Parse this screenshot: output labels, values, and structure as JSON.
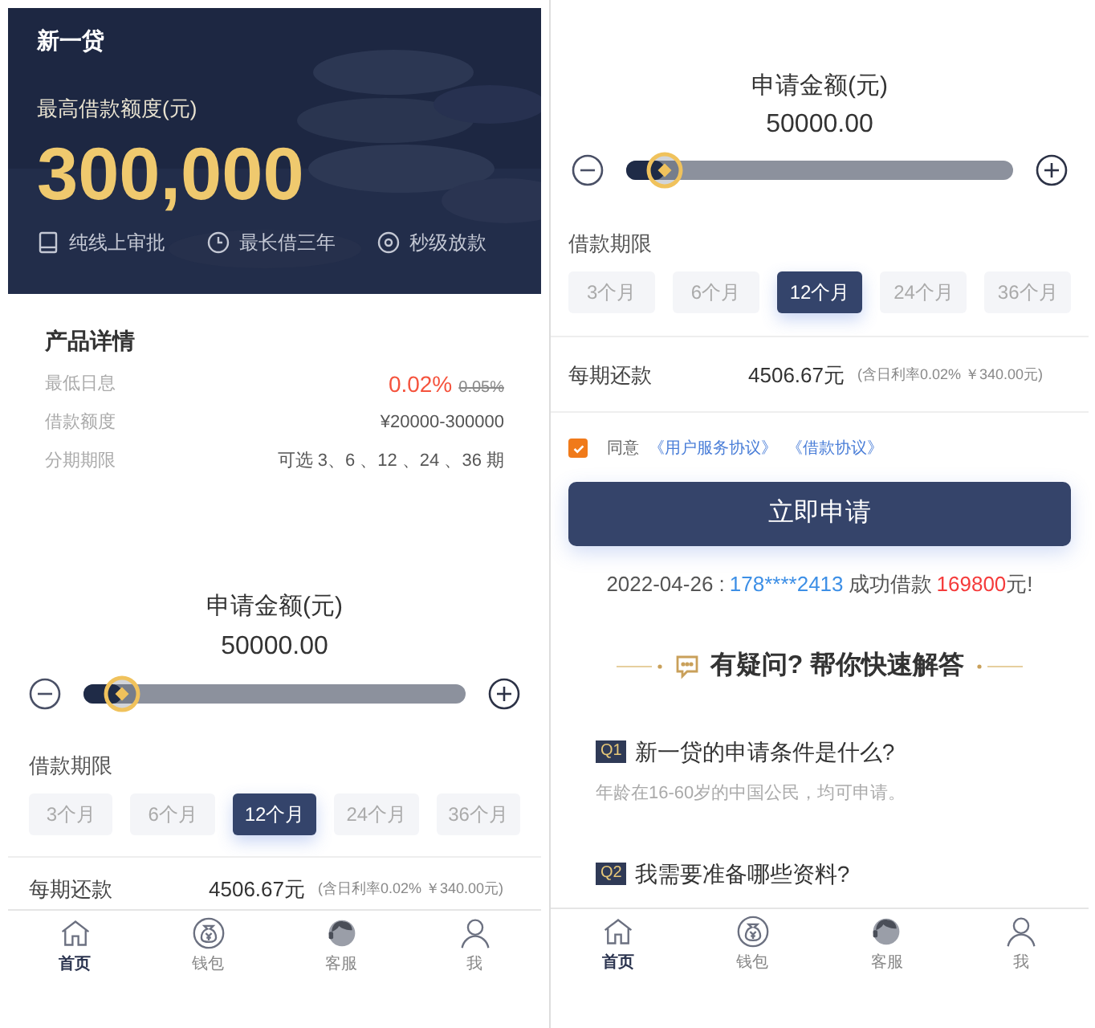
{
  "screens": [
    {
      "header": {
        "title": "新一贷",
        "limit_label": "最高借款额度(元)",
        "limit_value": "300,000",
        "features": [
          {
            "kind": "tablet",
            "label": "纯线上审批"
          },
          {
            "kind": "clock",
            "label": "最长借三年"
          },
          {
            "kind": "target",
            "label": "秒级放款"
          }
        ]
      },
      "details": {
        "title": "产品详情",
        "rows": [
          {
            "label": "最低日息",
            "value": "0.02%",
            "original": "0.05%"
          },
          {
            "label": "借款额度",
            "value": "¥20000-300000"
          },
          {
            "label": "分期期限",
            "value": "可选 3、6 、12 、24 、36 期"
          }
        ]
      },
      "amount": {
        "label": "申请金额(元)",
        "value": "50000.00",
        "level": 0.1
      },
      "terms": {
        "label": "借款期限",
        "options": [
          {
            "label": "3个月",
            "selected": false
          },
          {
            "label": "6个月",
            "selected": false
          },
          {
            "label": "12个月",
            "selected": true
          },
          {
            "label": "24个月",
            "selected": false
          },
          {
            "label": "36个月",
            "selected": false
          }
        ]
      },
      "repayment": {
        "label": "每期还款",
        "value": "4506.67元",
        "note": "(含日利率0.02% ￥340.00元)"
      },
      "tab_bar": [
        {
          "kind": "home",
          "label": "首页",
          "selected": true
        },
        {
          "kind": "wallet",
          "label": "钱包",
          "selected": false
        },
        {
          "kind": "service",
          "label": "客服",
          "selected": false
        },
        {
          "kind": "user",
          "label": "我",
          "selected": false
        }
      ]
    },
    {
      "amount": {
        "label": "申请金额(元)",
        "value": "50000.00",
        "level": 0.1
      },
      "terms": {
        "label": "借款期限",
        "options": [
          {
            "label": "3个月",
            "selected": false
          },
          {
            "label": "6个月",
            "selected": false
          },
          {
            "label": "12个月",
            "selected": true
          },
          {
            "label": "24个月",
            "selected": false
          },
          {
            "label": "36个月",
            "selected": false
          }
        ]
      },
      "repayment": {
        "label": "每期还款",
        "value": "4506.67元",
        "note": "(含日利率0.02% ￥340.00元)"
      },
      "agreement": {
        "checked": true,
        "prefix": "同意",
        "links": [
          "《用户服务协议》",
          "《借款协议》"
        ]
      },
      "apply_button": "立即申请",
      "ticker": {
        "date": "2022-04-26 :",
        "phone": "178****2413",
        "middle": "成功借款",
        "amount": "169800",
        "suffix": "元!"
      },
      "faq": {
        "title": "有疑问? 帮你快速解答",
        "items": [
          {
            "tag": "Q1",
            "question": "新一贷的申请条件是什么?",
            "answer": "年龄在16-60岁的中国公民，均可申请。"
          },
          {
            "tag": "Q2",
            "question": "我需要准备哪些资料?"
          }
        ]
      },
      "tab_bar": [
        {
          "kind": "home",
          "label": "首页",
          "selected": true
        },
        {
          "kind": "wallet",
          "label": "钱包",
          "selected": false
        },
        {
          "kind": "service",
          "label": "客服",
          "selected": false
        },
        {
          "kind": "user",
          "label": "我",
          "selected": false
        }
      ]
    }
  ]
}
